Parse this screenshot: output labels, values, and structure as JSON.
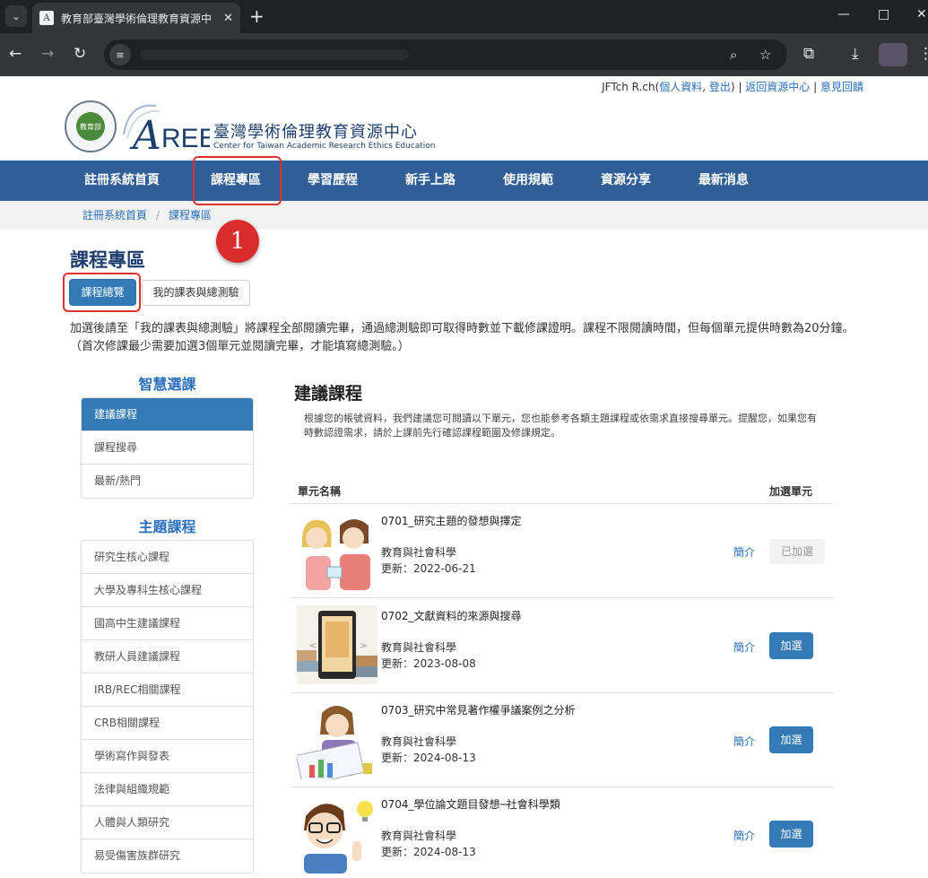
{
  "browser": {
    "tab_title": "教育部臺灣學術倫理教育資源中",
    "favicon_text": "A"
  },
  "userbar": {
    "user_name": "JFTch R.ch(",
    "profile_link": "個人資料",
    "comma": ", ",
    "logout_link": "登出",
    "close_paren": ")",
    "sep1": " | ",
    "return_link": "返回資源中心",
    "sep2": " | ",
    "feedback_link": "意見回饋"
  },
  "header": {
    "seal_text": "教育部",
    "logo_a": "A",
    "logo_ree": "REE",
    "site_title": "臺灣學術倫理教育資源中心",
    "site_subtitle": "Center for Taiwan Academic Research Ethics Education"
  },
  "nav": {
    "items": [
      "註冊系統首頁",
      "課程專區",
      "學習歷程",
      "新手上路",
      "使用規範",
      "資源分享",
      "最新消息"
    ]
  },
  "breadcrumb": {
    "home": "註冊系統首頁",
    "separator": "/",
    "current": "課程專區"
  },
  "annotation": {
    "step_number": "1",
    "highlight_color": "#e03030",
    "badge_color": "#d92d2d"
  },
  "page": {
    "heading": "課程專區",
    "btn_overview": "課程總覽",
    "btn_my_courses": "我的課表與總測驗",
    "intro": "加選後請至「我的課表與總測驗」將課程全部閱讀完畢，通過總測驗即可取得時數並下載修課證明。課程不限閱讀時間，但每個單元提供時數為20分鐘。（首次修課最少需要加選3個單元並閱讀完畢，才能填寫總測驗。）"
  },
  "sidebar": {
    "smart_heading": "智慧選課",
    "smart_items": [
      "建議課程",
      "課程搜尋",
      "最新/熱門"
    ],
    "theme_heading": "主題課程",
    "theme_items": [
      "研究生核心課程",
      "大學及專科生核心課程",
      "國高中生建議課程",
      "教研人員建議課程",
      "IRB/REC相關課程",
      "CRB相關課程",
      "學術寫作與發表",
      "法律與組織規範",
      "人體與人類研究",
      "易受傷害族群研究"
    ]
  },
  "content": {
    "heading": "建議課程",
    "desc": "根據您的帳號資料，我們建議您可閱讀以下單元，您也能參考各類主題課程或依需求直接搜尋單元。提醒您，如果您有時數認證需求，請於上課前先行確認課程範圍及修課規定。",
    "col_unit": "單元名稱",
    "col_add": "加選單元",
    "rows": [
      {
        "title": "0701_研究主題的發想與擇定",
        "category": "教育與社會科學",
        "updated": "更新：2022-06-21",
        "intro_link": "簡介",
        "action": "已加選"
      },
      {
        "title": "0702_文獻資料的來源與搜尋",
        "category": "教育與社會科學",
        "updated": "更新：2023-08-08",
        "intro_link": "簡介",
        "action": "加選"
      },
      {
        "title": "0703_研究中常見著作權爭議案例之分析",
        "category": "教育與社會科學",
        "updated": "更新：2024-08-13",
        "intro_link": "簡介",
        "action": "加選"
      },
      {
        "title": "0704_學位論文題目發想─社會科學類",
        "category": "教育與社會科學",
        "updated": "更新：2024-08-13",
        "intro_link": "簡介",
        "action": "加選"
      }
    ]
  },
  "colors": {
    "nav_bg": "#2f5f96",
    "primary": "#337ab7",
    "link": "#2a6ebb",
    "title_navy": "#1e3f6e"
  }
}
